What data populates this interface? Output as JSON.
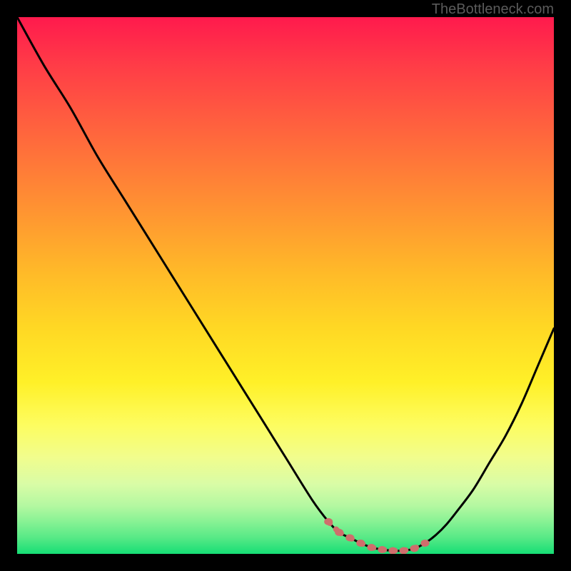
{
  "attribution": "TheBottleneck.com",
  "colors": {
    "background": "#000000",
    "gradient_top": "#ff1a4d",
    "gradient_bottom": "#16de75",
    "curve": "#000000",
    "marker": "#cf6e6c"
  },
  "chart_data": {
    "type": "line",
    "title": "",
    "xlabel": "",
    "ylabel": "",
    "xlim": [
      0,
      100
    ],
    "ylim": [
      0,
      100
    ],
    "grid": false,
    "legend": false,
    "series": [
      {
        "name": "bottleneck-curve",
        "x": [
          0,
          5,
          10,
          15,
          20,
          25,
          30,
          35,
          40,
          45,
          50,
          55,
          58,
          60,
          62,
          64,
          66,
          68,
          70,
          72,
          74,
          76,
          78,
          80,
          82,
          85,
          88,
          91,
          94,
          97,
          100
        ],
        "values": [
          100,
          91,
          83,
          74,
          66,
          58,
          50,
          42,
          34,
          26,
          18,
          10,
          6,
          4,
          3,
          2,
          1.2,
          0.8,
          0.6,
          0.6,
          1.0,
          2.0,
          3.5,
          5.5,
          8,
          12,
          17,
          22,
          28,
          35,
          42
        ]
      }
    ],
    "markers": {
      "name": "optimal-zone-dots",
      "x": [
        58,
        60,
        62,
        64,
        66,
        68,
        70,
        72,
        74,
        76
      ],
      "values": [
        6,
        4,
        3,
        2,
        1.2,
        0.8,
        0.6,
        0.6,
        1.0,
        2.0
      ]
    }
  }
}
